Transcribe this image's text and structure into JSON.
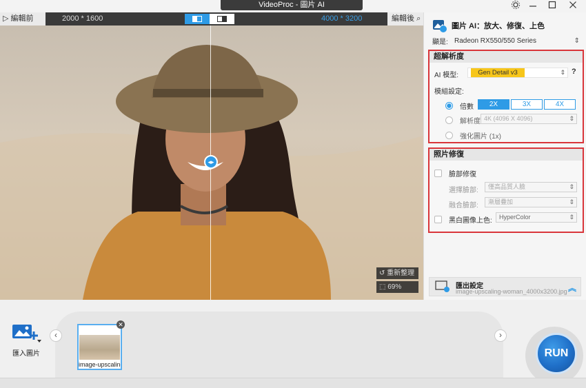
{
  "window": {
    "title": "VideoProc - 圖片 AI",
    "controls": [
      "settings-icon",
      "minimize-icon",
      "maximize-icon",
      "close-icon"
    ]
  },
  "compare": {
    "before_label": "編輯前",
    "after_label": "編輯後",
    "before_res": "2000 * 1600",
    "after_res": "4000 * 3200"
  },
  "preview": {
    "reset_label": "重新整理",
    "zoom": "69%"
  },
  "panel": {
    "title": "圖片 AI：放大、修復、上色",
    "gpu_label": "顯是:",
    "gpu_value": "Radeon RX550/550 Series",
    "superres": {
      "heading": "超解析度",
      "model_label": "AI 模型:",
      "model_value": "Gen Detail v3",
      "mode_label": "模組設定:",
      "scale_label": "倍數",
      "scale_options": [
        "2X",
        "3X",
        "4X"
      ],
      "selected_scale": "2X",
      "resolution_label": "解析度",
      "resolution_value": "4K (4096 X 4096)",
      "enhance_label": "強化圖片 (1x)"
    },
    "repair": {
      "heading": "照片修復",
      "face_label": "臉部修復",
      "select_face_label": "選擇臉部:",
      "select_face_value": "僅高品質人臉",
      "blend_label": "融合臉部:",
      "blend_value": "漸層疊加",
      "colorize_label": "黑白圖像上色:",
      "colorize_value": "HyperColor"
    },
    "export": {
      "title": "匯出設定",
      "filename": "image-upscaling-woman_4000x3200.jpg"
    }
  },
  "bottom": {
    "import_label": "匯入圖片",
    "thumb_label": "image-upscaling-",
    "run_label": "RUN"
  },
  "colors": {
    "accent": "#2e9be6",
    "highlight_border": "#d9353a",
    "model_badge": "#f7c61a",
    "run": "#1f6fc8"
  }
}
